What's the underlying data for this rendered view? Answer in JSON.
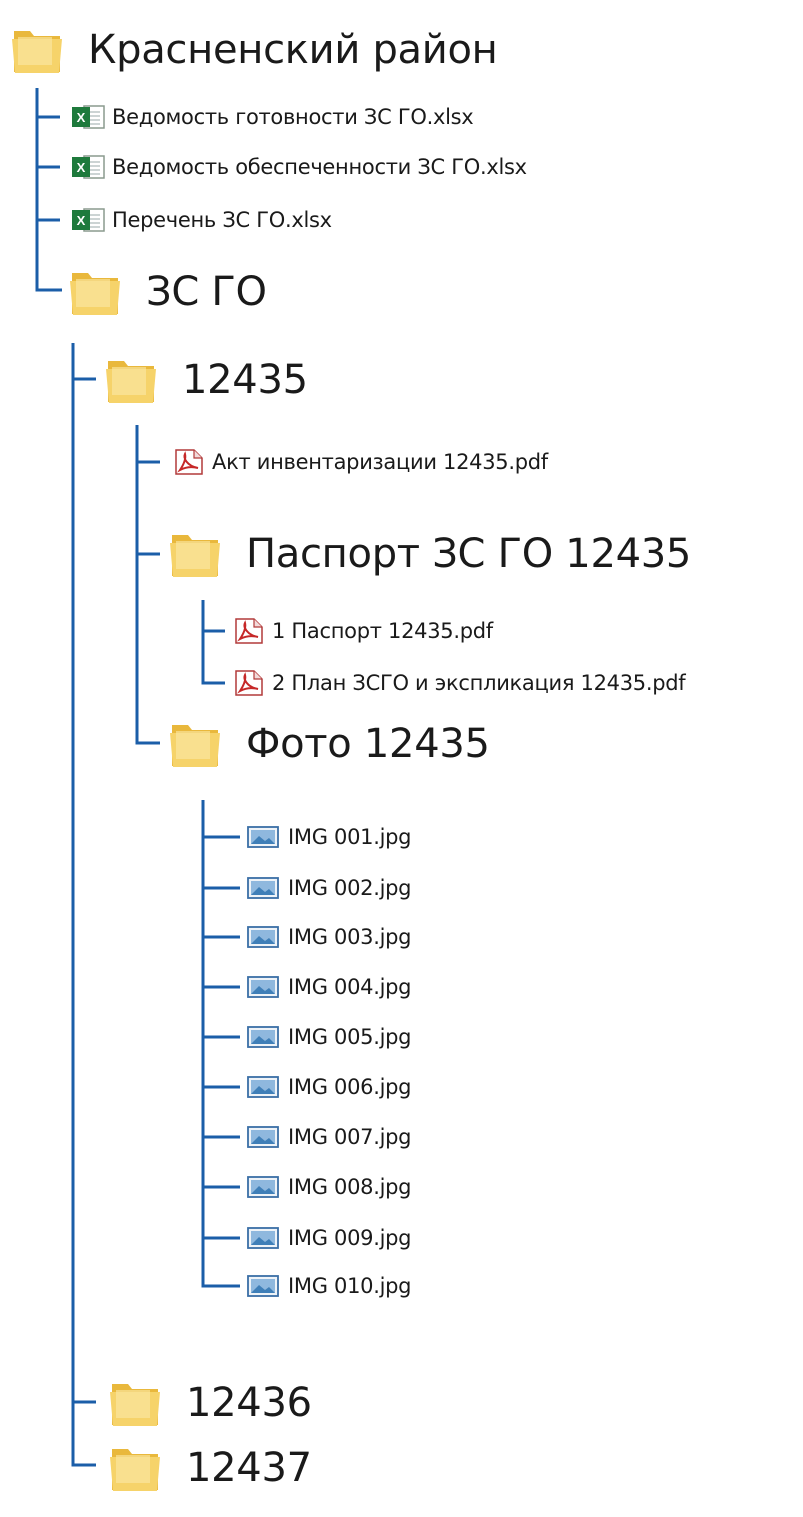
{
  "colors": {
    "tree_line": "#1b5ea8",
    "folder": "#f2c84a",
    "excel": "#1e7a3c",
    "pdf": "#c62828",
    "image_file": "#5a8cc4"
  },
  "tree": {
    "root": {
      "label": "Красненский район",
      "icon": "folder-icon"
    },
    "root_files": [
      {
        "label": "Ведомость готовности ЗС ГО.xlsx",
        "icon": "excel-file-icon"
      },
      {
        "label": "Ведомость обеспеченности ЗС ГО.xlsx",
        "icon": "excel-file-icon"
      },
      {
        "label": "Перечень ЗС ГО.xlsx",
        "icon": "excel-file-icon"
      }
    ],
    "zs_go": {
      "label": "ЗС ГО",
      "icon": "folder-icon"
    },
    "folder_12435": {
      "label": "12435",
      "icon": "folder-icon"
    },
    "act_file": {
      "label": "Акт инвентаризации 12435.pdf",
      "icon": "pdf-file-icon"
    },
    "passport_folder": {
      "label": "Паспорт ЗС ГО 12435",
      "icon": "folder-icon"
    },
    "passport_files": [
      {
        "label": "1 Паспорт 12435.pdf",
        "icon": "pdf-file-icon"
      },
      {
        "label": "2 План ЗСГО и экспликация 12435.pdf",
        "icon": "pdf-file-icon"
      }
    ],
    "photo_folder": {
      "label": "Фото 12435",
      "icon": "folder-icon"
    },
    "photo_files": [
      {
        "label": "IMG 001.jpg",
        "icon": "image-file-icon"
      },
      {
        "label": "IMG 002.jpg",
        "icon": "image-file-icon"
      },
      {
        "label": "IMG 003.jpg",
        "icon": "image-file-icon"
      },
      {
        "label": "IMG 004.jpg",
        "icon": "image-file-icon"
      },
      {
        "label": "IMG 005.jpg",
        "icon": "image-file-icon"
      },
      {
        "label": "IMG 006.jpg",
        "icon": "image-file-icon"
      },
      {
        "label": "IMG 007.jpg",
        "icon": "image-file-icon"
      },
      {
        "label": "IMG 008.jpg",
        "icon": "image-file-icon"
      },
      {
        "label": "IMG 009.jpg",
        "icon": "image-file-icon"
      },
      {
        "label": "IMG 010.jpg",
        "icon": "image-file-icon"
      }
    ],
    "folder_12436": {
      "label": "12436",
      "icon": "folder-icon"
    },
    "folder_12437": {
      "label": "12437",
      "icon": "folder-icon"
    }
  }
}
